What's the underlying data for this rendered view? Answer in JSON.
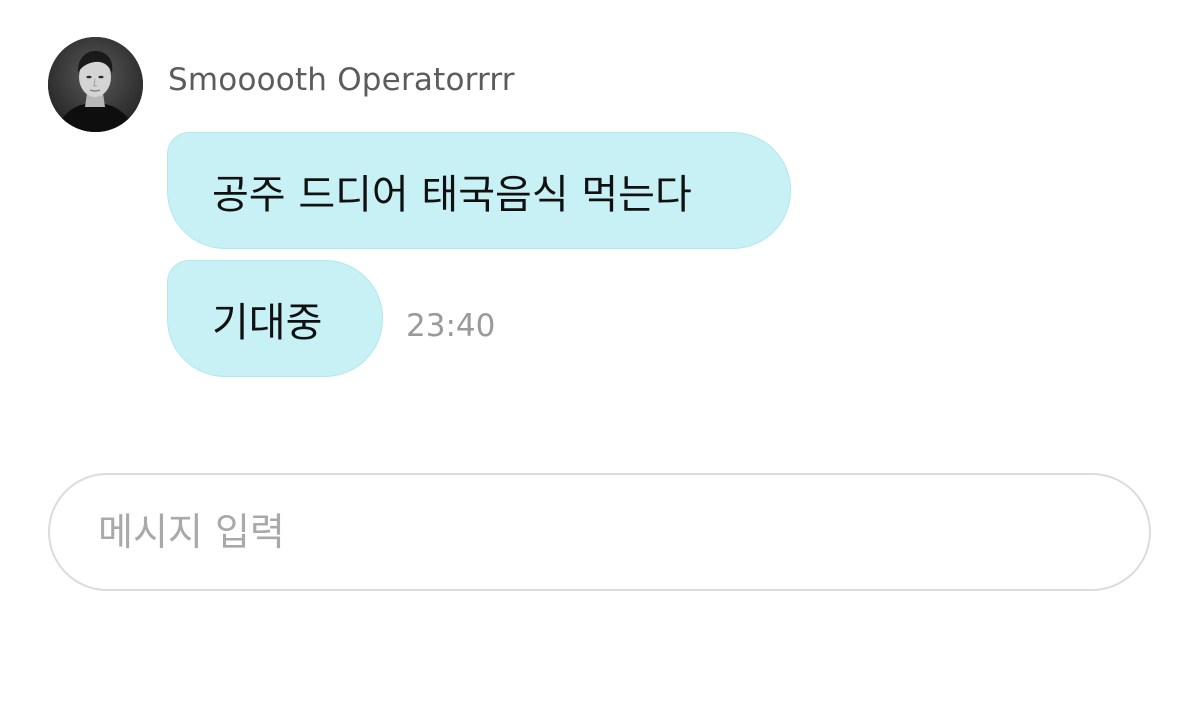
{
  "header": {
    "sender_name": "Smooooth Operatorrrr",
    "avatar_icon": "profile-photo-icon"
  },
  "messages": [
    {
      "text": "공주 드디어 태국음식 먹는다"
    },
    {
      "text": "기대중",
      "time": "23:40"
    }
  ],
  "composer": {
    "placeholder": "메시지 입력",
    "value": ""
  },
  "colors": {
    "bubble": "#c7f1f5",
    "bubble_border": "#b3e7ee",
    "name_text": "#5c5c5c",
    "time_text": "#9a9a9a",
    "input_border": "#dcdcdc",
    "placeholder_text": "#a9a9a9"
  }
}
